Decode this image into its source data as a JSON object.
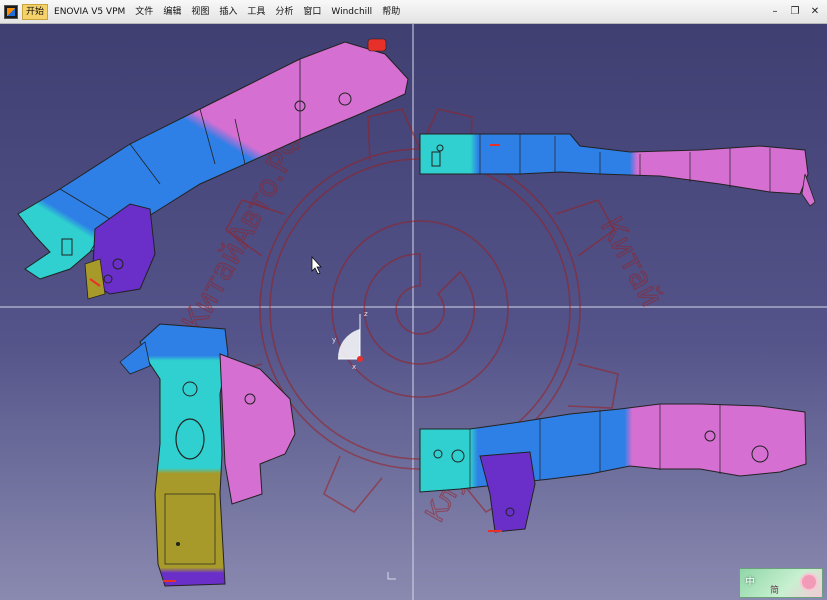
{
  "menubar": {
    "items": [
      "开始",
      "ENOVIA V5 VPM",
      "文件",
      "编辑",
      "视图",
      "插入",
      "工具",
      "分析",
      "窗口",
      "Windchill",
      "帮助"
    ]
  },
  "window_controls": {
    "minimize": "–",
    "restore": "❐",
    "close": "✕"
  },
  "watermark": {
    "arc_text_left": "КитайАвто.РФ",
    "arc_text_right": "Китай",
    "arc_text_bottom": "Клуб"
  },
  "compass": {
    "axis_x": "x",
    "axis_y": "y",
    "axis_z": "z"
  },
  "ime": {
    "label": "中",
    "label2": "简"
  },
  "colors": {
    "viewport_top": "#3f3f72",
    "viewport_bottom": "#8a8ab0",
    "part_cyan": "#2fd0cf",
    "part_blue": "#2e7fe6",
    "part_magenta": "#d66fd2",
    "part_purple": "#6a2fc9",
    "part_olive": "#a89a2a",
    "watermark": "#9a1f1f"
  }
}
